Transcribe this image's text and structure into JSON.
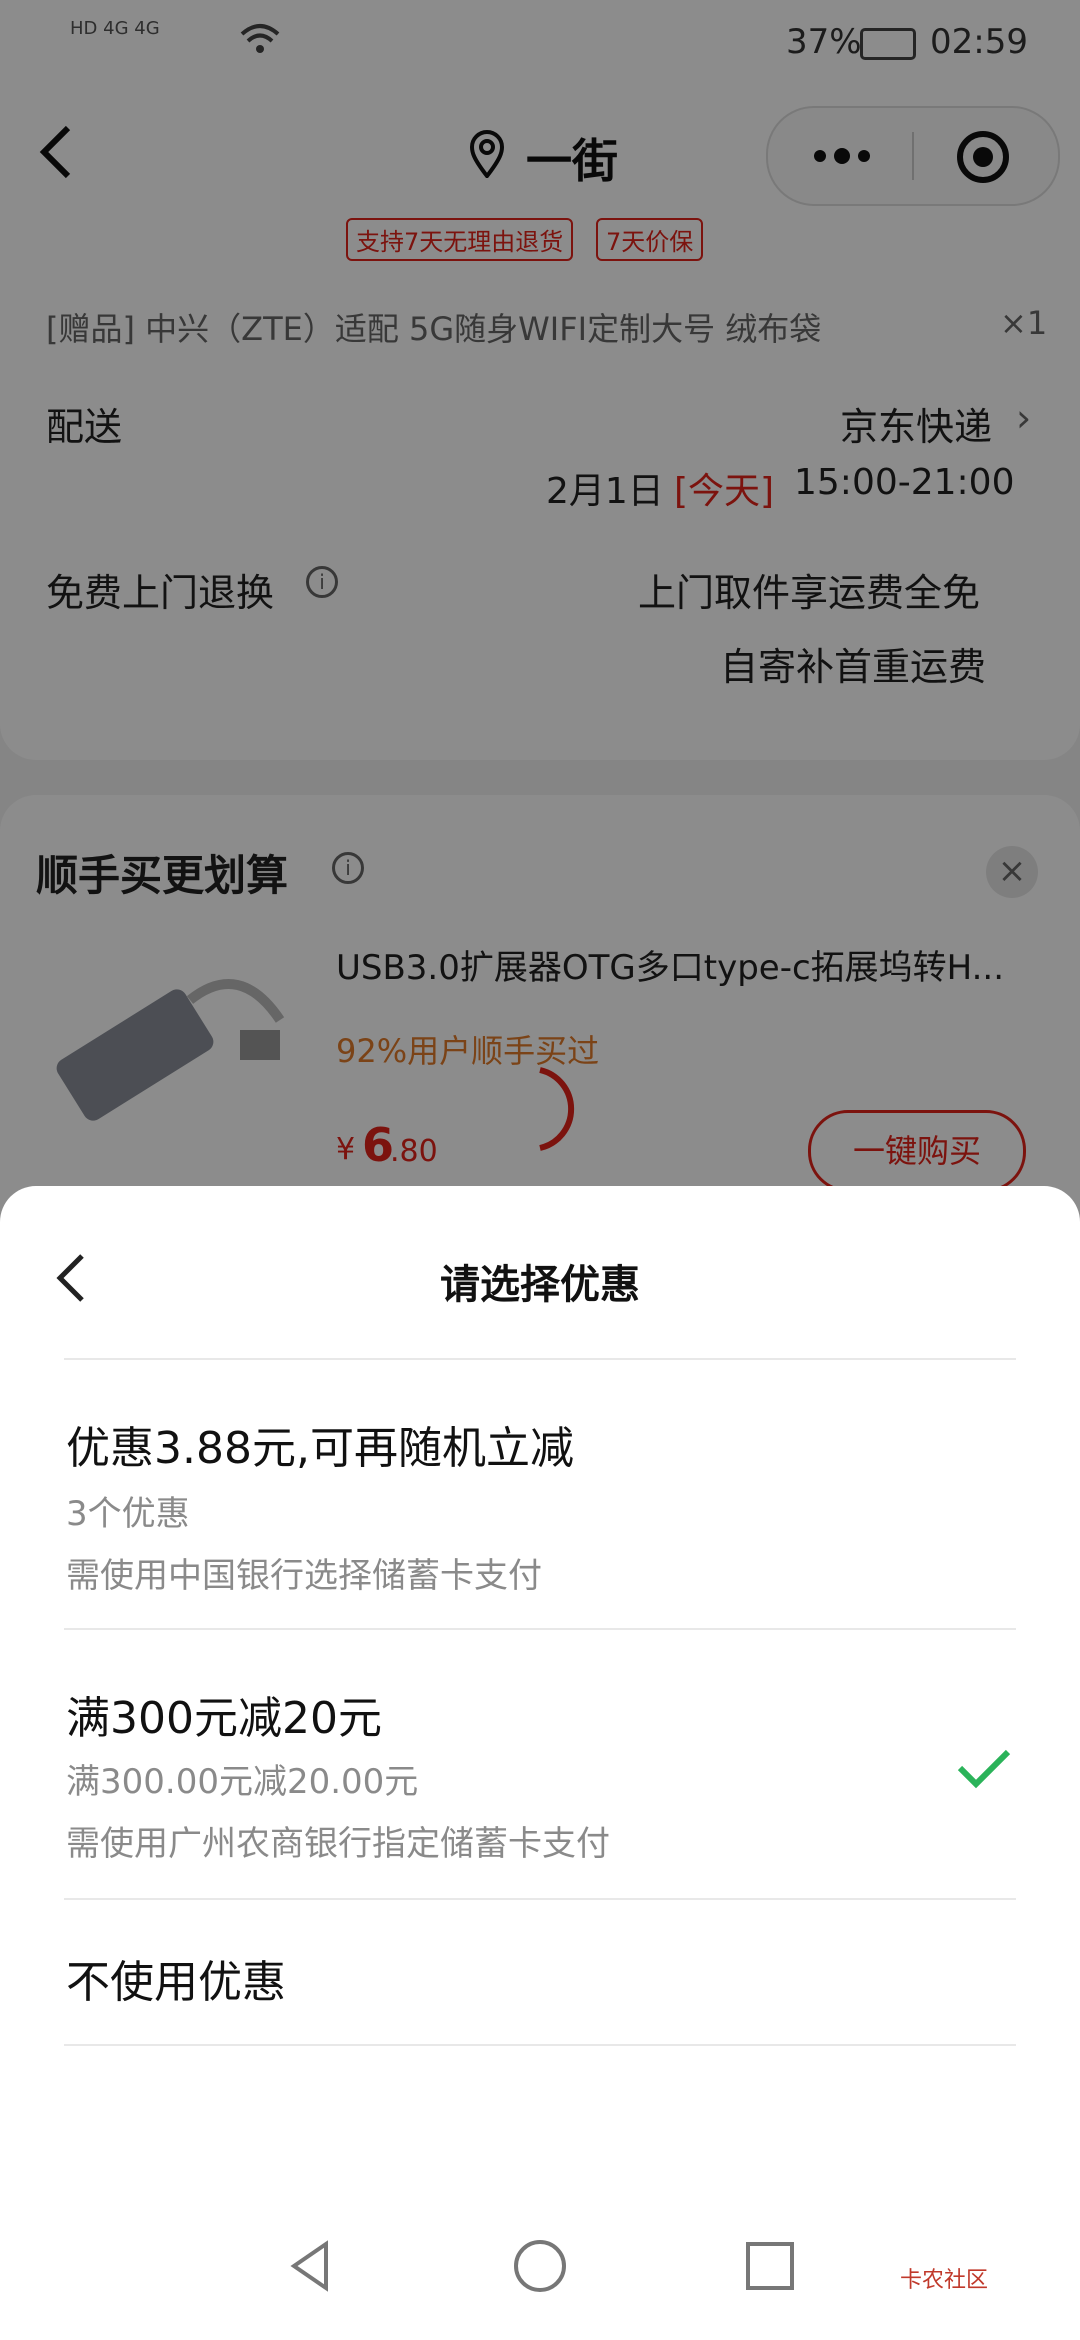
{
  "status_bar": {
    "network": "HD 4G 4G",
    "battery": "37%",
    "time": "02:59"
  },
  "nav": {
    "title": "一街"
  },
  "product": {
    "tags": [
      "支持7天无理由退货",
      "7天价保"
    ],
    "gift": {
      "text": "[赠品] 中兴（ZTE）适配 5G随身WIFI定制大号 绒布袋",
      "qty": "×1"
    }
  },
  "delivery": {
    "label": "配送",
    "carrier": "京东快递",
    "date": "2月1日",
    "today": "[今天]",
    "time": "15:00-21:00"
  },
  "returns": {
    "label": "免费上门退换",
    "line1": "上门取件享运费全免",
    "line2": "自寄补首重运费"
  },
  "addon": {
    "title": "顺手买更划算",
    "product_name": "USB3.0扩展器OTG多口type-c拓展坞转H...",
    "buyers": "92%用户顺手买过",
    "price_symbol": "¥",
    "price_int": "6",
    "price_dec": ".80",
    "buy_button": "一键购买"
  },
  "sheet": {
    "title": "请选择优惠",
    "options": [
      {
        "title": "优惠3.88元,可再随机立减",
        "sub1": "3个优惠",
        "sub2": "需使用中国银行选择储蓄卡支付",
        "selected": false
      },
      {
        "title": "满300元减20元",
        "sub1": "满300.00元减20.00元",
        "sub2": "需使用广州农商银行指定储蓄卡支付",
        "selected": true
      },
      {
        "title": "不使用优惠",
        "selected": false
      }
    ]
  },
  "watermark": "卡农社区",
  "colors": {
    "accent_red": "#e2231a",
    "check_green": "#2bb35a",
    "orange": "#e07b2a"
  }
}
